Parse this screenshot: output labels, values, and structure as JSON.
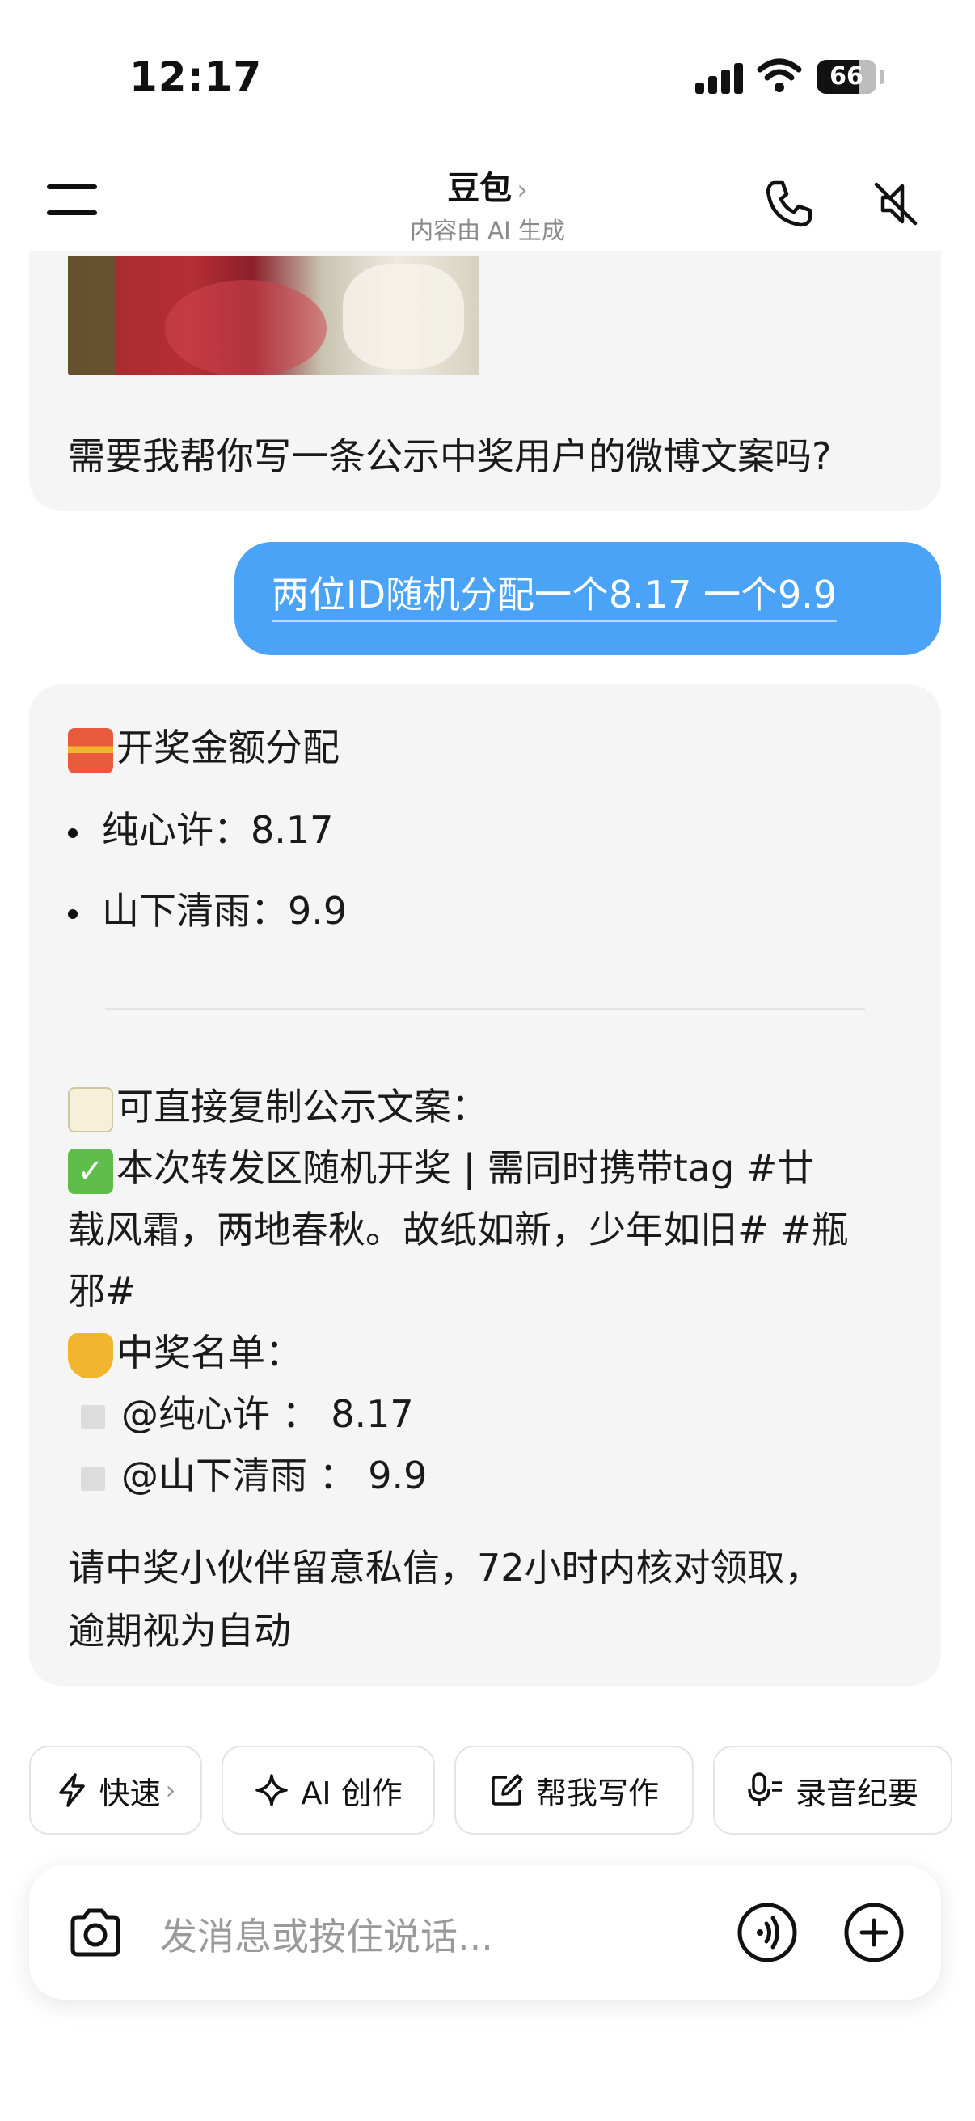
{
  "status_bar": {
    "time": "12:17",
    "battery": "66"
  },
  "header": {
    "title": "豆包",
    "title_chevron": "›",
    "subtitle": "内容由 AI 生成"
  },
  "messages": {
    "bot1": {
      "text": "需要我帮你写一条公示中奖用户的微博文案吗?"
    },
    "user1": {
      "text": "两位ID随机分配一个8.17   一个9.9"
    },
    "bot2": {
      "heading": "开奖金额分配",
      "bullets": [
        "纯心许：8.17",
        "山下清雨：9.9"
      ],
      "copy_title": "可直接复制公示文案：",
      "line1": "本次转发区随机开奖 | 需同时携带tag #廿",
      "line2": "载风霜，两地春秋。故纸如新，少年如旧# #瓶",
      "line3": "邪#",
      "winners_title": "中奖名单：",
      "winners": [
        "@纯心许 ：  8.17",
        "@山下清雨 ：  9.9"
      ],
      "footer1": "请中奖小伙伴留意私信，72小时内核对领取，",
      "footer2": "逾期视为自动"
    }
  },
  "quick_actions": {
    "fast": "快速",
    "fast_chevron": "›",
    "ai_create": "AI 创作",
    "write": "帮我写作",
    "record": "录音纪要"
  },
  "input": {
    "placeholder": "发消息或按住说话..."
  }
}
